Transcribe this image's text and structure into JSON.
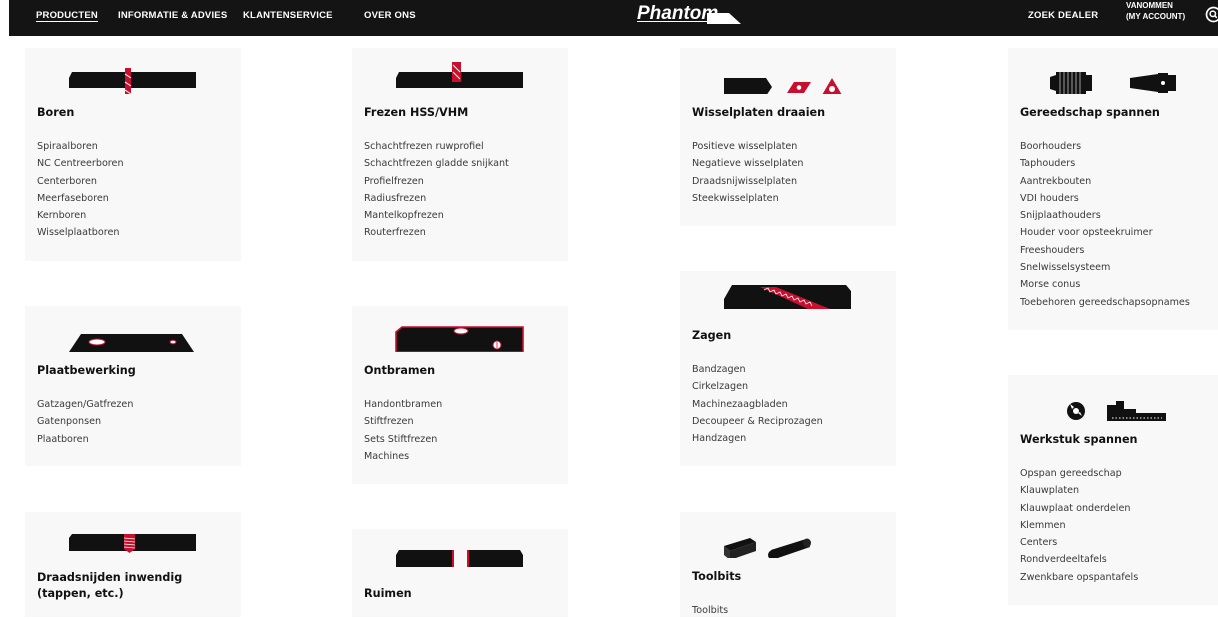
{
  "nav": {
    "items": [
      "PRODUCTEN",
      "INFORMATIE & ADVIES",
      "KLANTENSERVICE",
      "OVER ONS"
    ],
    "brand": "Phantom",
    "dealer": "ZOEK DEALER",
    "account_line1": "VANOMMEN",
    "account_line2": "(MY ACCOUNT)",
    "search_icon": "search-icon"
  },
  "colors": {
    "accent": "#c8102e",
    "bar": "#141414",
    "card": "#f8f8f8"
  },
  "categories": [
    {
      "title": "Boren",
      "icon": "drill-icon",
      "items": [
        "Spiraalboren",
        "NC Centreerboren",
        "Centerboren",
        "Meerfaseboren",
        "Kernboren",
        "Wisselplaatboren"
      ]
    },
    {
      "title": "Frezen HSS/VHM",
      "icon": "milling-icon",
      "items": [
        "Schachtfrezen ruwprofiel",
        "Schachtfrezen gladde snijkant",
        "Profielfrezen",
        "Radiusfrezen",
        "Mantelkopfrezen",
        "Routerfrezen"
      ]
    },
    {
      "title": "Wisselplaten draaien",
      "icon": "turning-inserts-icon",
      "items": [
        "Positieve wisselplaten",
        "Negatieve wisselplaten",
        "Draadsnijwisselplaten",
        "Steekwisselplaten"
      ]
    },
    {
      "title": "Gereedschap spannen",
      "icon": "tool-holder-icon",
      "items": [
        "Boorhouders",
        "Taphouders",
        "Aantrekbouten",
        "VDI houders",
        "Snijplaathouders",
        "Houder voor opsteekruimer",
        "Freeshouders",
        "Snelwisselsysteem",
        "Morse conus",
        "Toebehoren gereedschapsopnames"
      ]
    },
    {
      "title": "Plaatbewerking",
      "icon": "sheet-metal-icon",
      "items": [
        "Gatzagen/Gatfrezen",
        "Gatenponsen",
        "Plaatboren"
      ]
    },
    {
      "title": "Ontbramen",
      "icon": "deburring-icon",
      "items": [
        "Handontbramen",
        "Stiftfrezen",
        "Sets Stiftfrezen",
        "Machines"
      ]
    },
    {
      "title": "Zagen",
      "icon": "saw-icon",
      "items": [
        "Bandzagen",
        "Cirkelzagen",
        "Machinezaagbladen",
        "Decoupeer & Reciprozagen",
        "Handzagen"
      ]
    },
    {
      "title": "Werkstuk spannen",
      "icon": "workholding-icon",
      "items": [
        "Opspan gereedschap",
        "Klauwplaten",
        "Klauwplaat onderdelen",
        "Klemmen",
        "Centers",
        "Rondverdeeltafels",
        "Zwenkbare opspantafels"
      ]
    },
    {
      "title": "Draadsnijden inwendig (tappen, etc.)",
      "icon": "tapping-icon",
      "items": []
    },
    {
      "title": "Ruimen",
      "icon": "reaming-icon",
      "items": []
    },
    {
      "title": "Toolbits",
      "icon": "toolbits-icon",
      "items": [
        "Toolbits"
      ]
    }
  ]
}
